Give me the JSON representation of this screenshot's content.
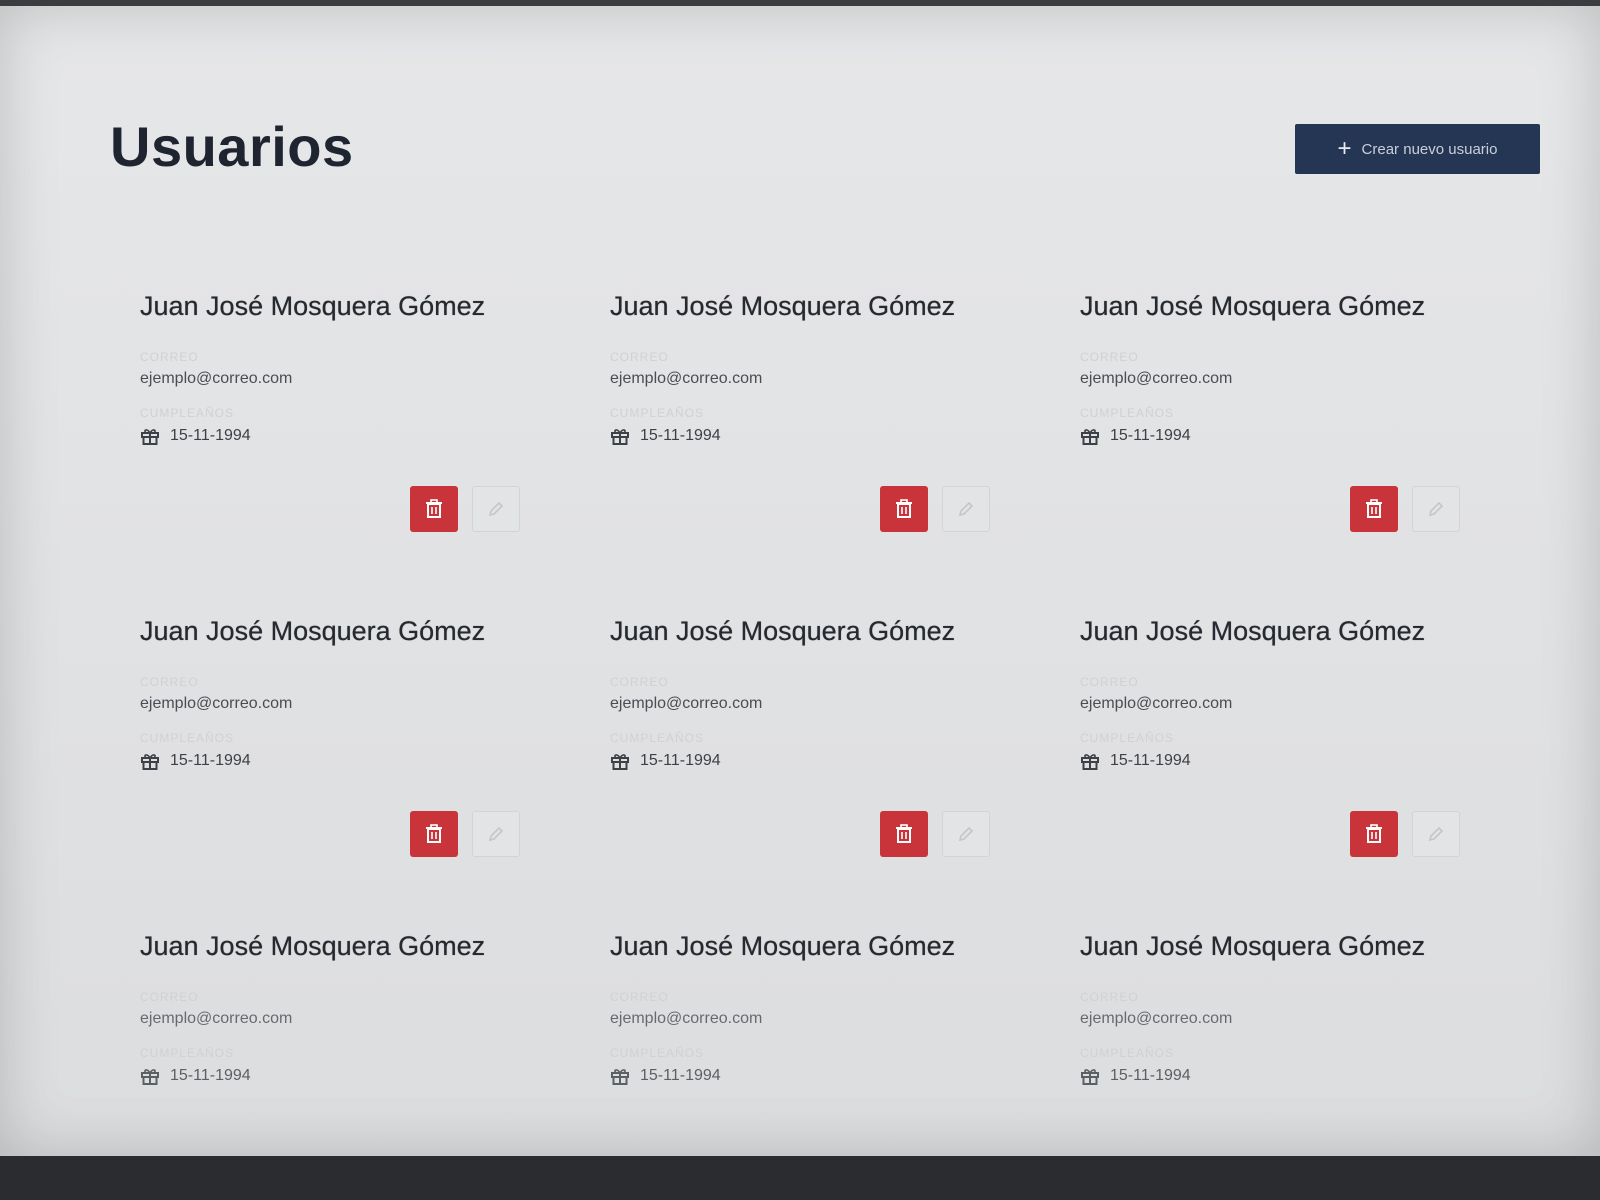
{
  "page": {
    "title": "Usuarios"
  },
  "header": {
    "create_button_label": "Crear nuevo usuario",
    "create_button_icon": "plus-icon"
  },
  "labels": {
    "email": "Correo",
    "birthday": "Cumpleaños"
  },
  "colors": {
    "primary": "#243653",
    "danger": "#c9343a",
    "title": "#1e2430"
  },
  "users": [
    {
      "name": "Juan José Mosquera Gómez",
      "email": "ejemplo@correo.com",
      "birthday": "15-11-1994"
    },
    {
      "name": "Juan José Mosquera Gómez",
      "email": "ejemplo@correo.com",
      "birthday": "15-11-1994"
    },
    {
      "name": "Juan José Mosquera Gómez",
      "email": "ejemplo@correo.com",
      "birthday": "15-11-1994"
    },
    {
      "name": "Juan José Mosquera Gómez",
      "email": "ejemplo@correo.com",
      "birthday": "15-11-1994"
    },
    {
      "name": "Juan José Mosquera Gómez",
      "email": "ejemplo@correo.com",
      "birthday": "15-11-1994"
    },
    {
      "name": "Juan José Mosquera Gómez",
      "email": "ejemplo@correo.com",
      "birthday": "15-11-1994"
    },
    {
      "name": "Juan José Mosquera Gómez",
      "email": "ejemplo@correo.com",
      "birthday": "15-11-1994"
    },
    {
      "name": "Juan José Mosquera Gómez",
      "email": "ejemplo@correo.com",
      "birthday": "15-11-1994"
    },
    {
      "name": "Juan José Mosquera Gómez",
      "email": "ejemplo@correo.com",
      "birthday": "15-11-1994"
    }
  ]
}
